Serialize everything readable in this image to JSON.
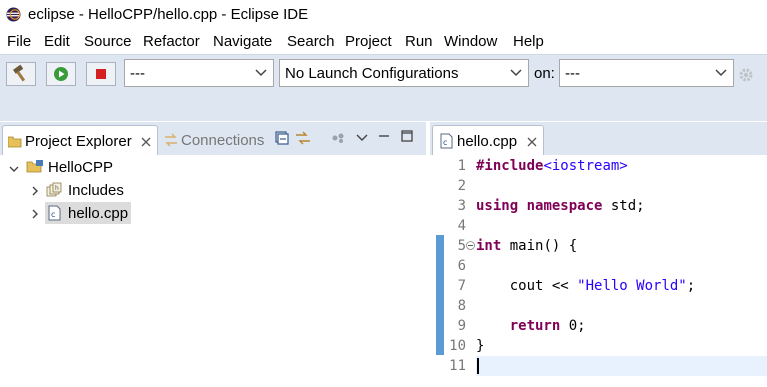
{
  "window": {
    "title": "eclipse - HelloCPP/hello.cpp - Eclipse IDE"
  },
  "menu": [
    "File",
    "Edit",
    "Source",
    "Refactor",
    "Navigate",
    "Search",
    "Project",
    "Run",
    "Window",
    "Help"
  ],
  "toolbar": {
    "mode_combo": "---",
    "launch_combo": "No Launch Configurations",
    "on_label": "on:",
    "target_combo": "---"
  },
  "left_panel": {
    "tabs": [
      {
        "label": "Project Explorer",
        "active": true
      },
      {
        "label": "Connections",
        "active": false
      }
    ],
    "tree": {
      "project": "HelloCPP",
      "children": [
        {
          "label": "Includes",
          "selected": false
        },
        {
          "label": "hello.cpp",
          "selected": true
        }
      ]
    }
  },
  "editor": {
    "tab": "hello.cpp",
    "lines": [
      {
        "n": "1",
        "text": "#include<iostream>"
      },
      {
        "n": "2",
        "text": ""
      },
      {
        "n": "3",
        "text": "using namespace std;"
      },
      {
        "n": "4",
        "text": ""
      },
      {
        "n": "5",
        "text": "int main() {"
      },
      {
        "n": "6",
        "text": ""
      },
      {
        "n": "7",
        "text": "    cout << \"Hello World\";"
      },
      {
        "n": "8",
        "text": ""
      },
      {
        "n": "9",
        "text": "    return 0;"
      },
      {
        "n": "10",
        "text": "}"
      },
      {
        "n": "11",
        "text": ""
      }
    ]
  },
  "colors": {
    "keyword": "#7f0055",
    "string": "#2a00ff",
    "toolbar_bg": "#dde6f1"
  }
}
